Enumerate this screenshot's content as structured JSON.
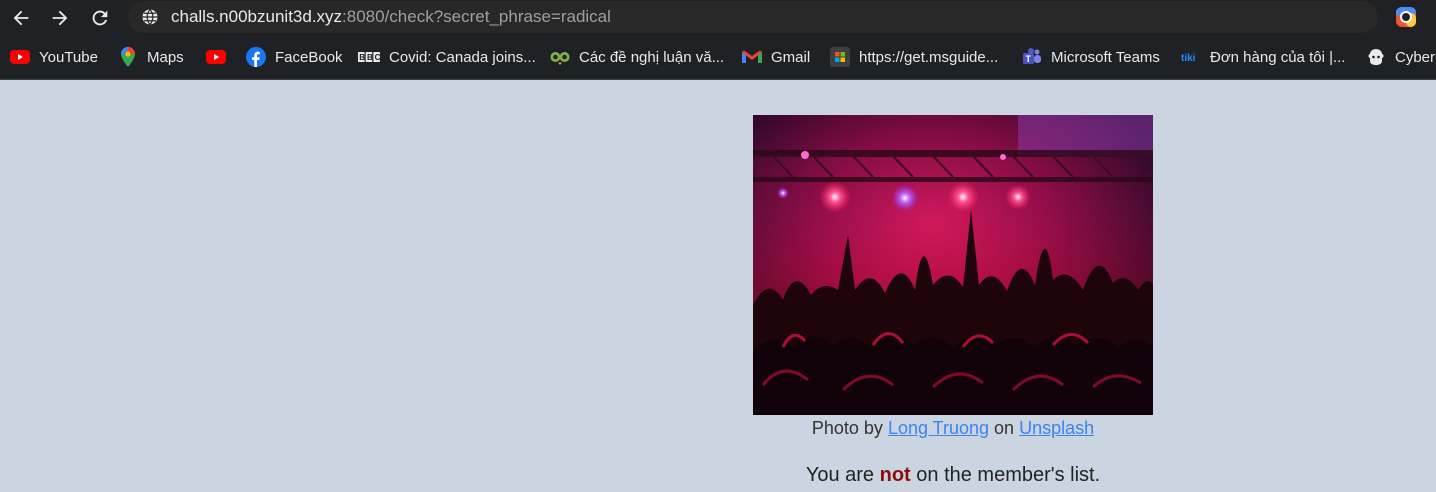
{
  "browser": {
    "url_host": "challs.n00bzunit3d.xyz",
    "url_rest": ":8080/check?secret_phrase=radical",
    "bookmarks": [
      {
        "label": "YouTube",
        "icon": "youtube-icon"
      },
      {
        "label": "Maps",
        "icon": "maps-icon"
      },
      {
        "label": "",
        "icon": "youtube-icon"
      },
      {
        "label": "FaceBook",
        "icon": "facebook-icon"
      },
      {
        "label": "Covid: Canada joins...",
        "icon": "bbc-icon"
      },
      {
        "label": "Các đề nghị luận vă...",
        "icon": "owl-icon"
      },
      {
        "label": "Gmail",
        "icon": "gmail-icon"
      },
      {
        "label": "https://get.msguide...",
        "icon": "msguide-icon"
      },
      {
        "label": "Microsoft Teams",
        "icon": "teams-icon"
      },
      {
        "label": "Đơn hàng của tôi |...",
        "icon": "tiki-icon"
      },
      {
        "label": "Cyber",
        "icon": "cyber-icon"
      }
    ]
  },
  "page": {
    "caption_prefix": "Photo by",
    "author": "Long Truong",
    "caption_mid": "on",
    "source": "Unsplash",
    "msg_before": "You are",
    "msg_strong": "not",
    "msg_after": "on the member's list."
  },
  "colors": {
    "page_background": "#cbd5e1",
    "link": "#3b82f6",
    "emphasis": "#8b0d0d"
  }
}
